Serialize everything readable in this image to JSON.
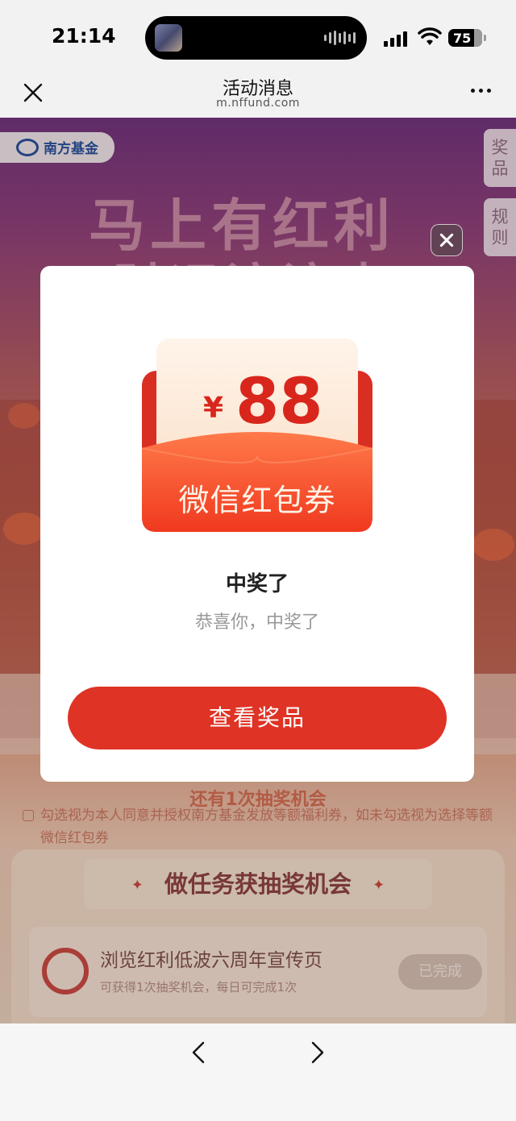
{
  "status_bar": {
    "time": "21:14",
    "battery": "75"
  },
  "nav": {
    "title": "活动消息",
    "url": "m.nffund.com"
  },
  "background": {
    "brand": "南方基金",
    "side_tabs": [
      "奖品",
      "规则"
    ],
    "hero_line1": "马上有红利",
    "hero_line2": "财运滚滚来",
    "chance_text": "还有1次抽奖机会",
    "consent_text": "勾选视为本人同意并授权南方基金发放等额福利券，如未勾选视为选择等额微信红包券",
    "task_header": "做任务获抽奖机会",
    "task": {
      "title": "浏览红利低波六周年宣传页",
      "desc": "可获得1次抽奖机会，每日可完成1次",
      "status": "已完成"
    }
  },
  "modal": {
    "currency": "¥",
    "amount": "88",
    "envelope_label": "微信红包券",
    "title": "中奖了",
    "subtitle": "恭喜你，中奖了",
    "button": "查看奖品"
  },
  "colors": {
    "accent": "#df3325",
    "envelope": "#d92e22"
  }
}
